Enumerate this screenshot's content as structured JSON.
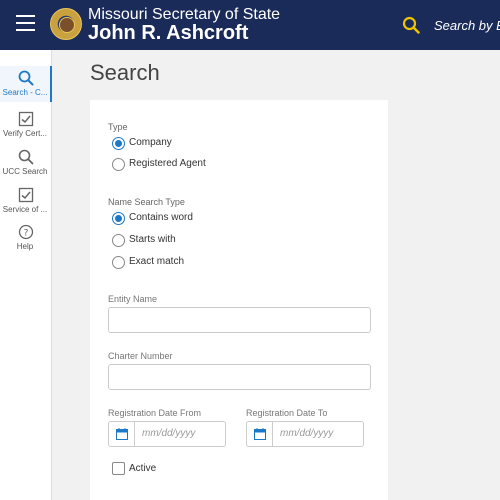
{
  "header": {
    "title_line1": "Missouri Secretary of State",
    "title_line2": "John R. Ashcroft",
    "search_text": "Search by Ent"
  },
  "sidebar": {
    "items": [
      {
        "label": "Search - C...",
        "icon": "search-icon"
      },
      {
        "label": "Verify Cert...",
        "icon": "check-square-icon"
      },
      {
        "label": "UCC Search",
        "icon": "search-icon"
      },
      {
        "label": "Service of ...",
        "icon": "check-square-icon"
      },
      {
        "label": "Help",
        "icon": "help-circle-icon"
      }
    ]
  },
  "main": {
    "title": "Search",
    "type_group": {
      "label": "Type",
      "options": [
        {
          "label": "Company",
          "selected": true
        },
        {
          "label": "Registered Agent",
          "selected": false
        }
      ]
    },
    "name_search_type": {
      "label": "Name Search Type",
      "options": [
        {
          "label": "Contains word",
          "selected": true
        },
        {
          "label": "Starts with",
          "selected": false
        },
        {
          "label": "Exact match",
          "selected": false
        }
      ]
    },
    "entity_name": {
      "label": "Entity Name",
      "value": "",
      "placeholder": ""
    },
    "charter_number": {
      "label": "Charter Number",
      "value": "",
      "placeholder": ""
    },
    "registration_date_from": {
      "label": "Registration Date From",
      "placeholder": "mm/dd/yyyy"
    },
    "registration_date_to": {
      "label": "Registration Date To",
      "placeholder": "mm/dd/yyyy"
    },
    "active": {
      "label": "Active",
      "checked": false
    }
  },
  "colors": {
    "header_bg": "#1b2b59",
    "accent": "#1e78c8",
    "search_icon": "#f2c300"
  }
}
